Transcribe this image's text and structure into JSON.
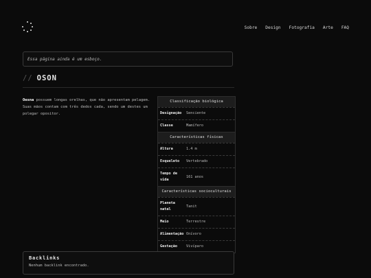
{
  "nav": [
    "Sobre",
    "Design",
    "Fotografia",
    "Arte",
    "FAQ"
  ],
  "notice": "Essa página ainda é um esboço.",
  "title_prefix": "//",
  "title": "OSON",
  "intro": {
    "name": "Oesna",
    "text": " possuem longas orelhas, que não apresentam pelagem. Suas mãos contam com três dedos cada, sendo um destes um polegar opositor."
  },
  "infobox": {
    "sections": [
      {
        "title": "Classificação biológica",
        "rows": [
          {
            "k": "Designação",
            "v": "Senciente"
          },
          {
            "k": "Classe",
            "v": "Mamífero"
          }
        ]
      },
      {
        "title": "Características físicas",
        "rows": [
          {
            "k": "Altura",
            "v": "1.4 m"
          },
          {
            "k": "Esqueleto",
            "v": "Vertebrado"
          },
          {
            "k": "Tempo de vida",
            "v": "161 anos"
          }
        ]
      },
      {
        "title": "Características socioculturais",
        "rows": [
          {
            "k": "Planeta natal",
            "v": "Tanit"
          },
          {
            "k": "Meio",
            "v": "Terrestre"
          },
          {
            "k": "Alimentação",
            "v": "Onívoro"
          },
          {
            "k": "Gestação",
            "v": "Vivíparo"
          }
        ]
      }
    ]
  },
  "backlinks": {
    "title": "Backlinks",
    "text": "Nenhum backlink encontrado."
  }
}
